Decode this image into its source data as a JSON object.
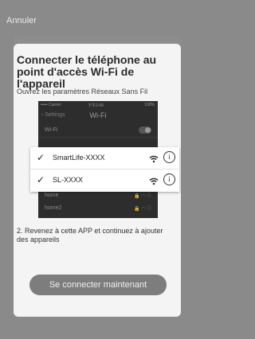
{
  "header": {
    "cancel_label": "Annuler"
  },
  "title": "Connecter le téléphone au point d'accès Wi-Fi de l'appareil",
  "subtitle": "Ouvrez les paramètres Réseaux Sans Fil",
  "phone": {
    "carrier": "••••• Carrier",
    "time": "下午2:49",
    "battery": "100%",
    "back_label": "Settings",
    "screen_title": "Wi-Fi",
    "wifi_toggle_label": "Wi-Fi",
    "networks": [
      {
        "name": "home"
      },
      {
        "name": "home2"
      }
    ]
  },
  "networks": [
    {
      "name": "SmartLife-XXXX",
      "check": "✓",
      "info": "i"
    },
    {
      "name": "SL-XXXX",
      "check": "✓",
      "info": "i"
    }
  ],
  "instruction": "2. Revenez à cette APP et continuez à ajouter des appareils",
  "connect_button": "Se connecter maintenant",
  "colors": {
    "overlay": "#8a8a8a",
    "card": "#f4f4f4",
    "button": "#7d7d7d",
    "phone_bg": "#2d2d2d"
  },
  "icons": {
    "wifi": "wifi-icon",
    "info": "info-icon",
    "check": "check-icon"
  }
}
